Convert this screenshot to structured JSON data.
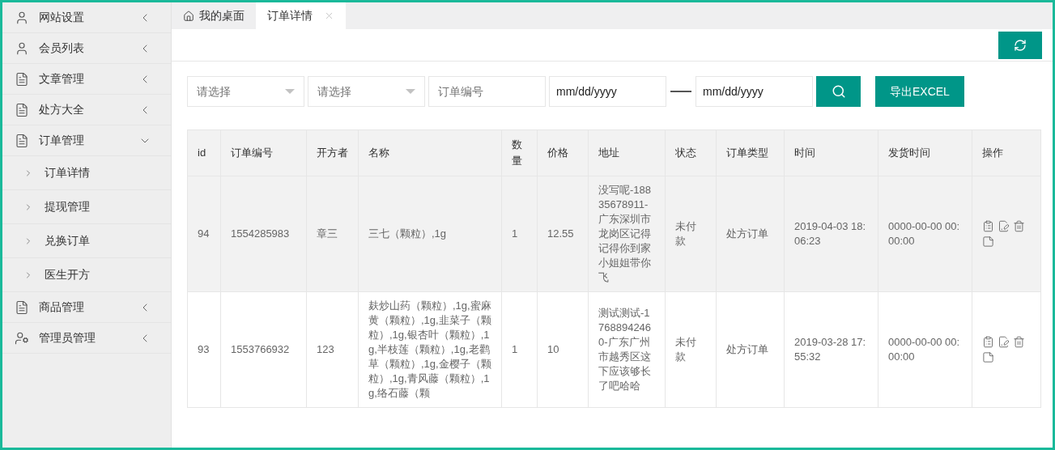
{
  "sidebar": {
    "items": [
      {
        "label": "网站设置",
        "kind": "user",
        "expanded": false
      },
      {
        "label": "会员列表",
        "kind": "user",
        "expanded": false
      },
      {
        "label": "文章管理",
        "kind": "doc",
        "expanded": false
      },
      {
        "label": "处方大全",
        "kind": "doc",
        "expanded": false
      },
      {
        "label": "订单管理",
        "kind": "doc",
        "expanded": true,
        "children": [
          {
            "label": "订单详情"
          },
          {
            "label": "提现管理"
          },
          {
            "label": "兑换订单"
          },
          {
            "label": "医生开方"
          }
        ]
      },
      {
        "label": "商品管理",
        "kind": "doc",
        "expanded": false
      },
      {
        "label": "管理员管理",
        "kind": "admin",
        "expanded": false
      }
    ]
  },
  "tabs": [
    {
      "label": "我的桌面",
      "kind": "home",
      "selected": false
    },
    {
      "label": "订单详情",
      "kind": "closable",
      "selected": true
    }
  ],
  "filters": {
    "selects": [
      {
        "placeholder": "请选择"
      },
      {
        "placeholder": "请选择"
      }
    ],
    "order_number": {
      "placeholder": "订单编号"
    },
    "date_from": {
      "placeholder": "mm/dd/yyyy"
    },
    "date_to": {
      "placeholder": "mm/dd/yyyy"
    },
    "export_button": "导出EXCEL"
  },
  "table": {
    "columns": [
      "id",
      "订单编号",
      "开方者",
      "名称",
      "数量",
      "价格",
      "地址",
      "状态",
      "订单类型",
      "时间",
      "发货时间",
      "操作"
    ],
    "rows": [
      {
        "hovered": true,
        "cells": [
          "94",
          "1554285983",
          "章三",
          "三七（颗粒）,1g",
          "1",
          "12.55",
          "没写呢-18835678911-广东深圳市龙岗区记得记得你到家小姐姐带你飞",
          "未付款",
          "处方订单",
          "2019-04-03 18:06:23",
          "0000-00-00 00:00:00"
        ]
      },
      {
        "hovered": false,
        "cells": [
          "93",
          "1553766932",
          "123",
          "麸炒山药（颗粒）,1g,蜜麻黄（颗粒）,1g,韭菜子（颗粒）,1g,银杏叶（颗粒）,1g,半枝莲（颗粒）,1g,老鹳草（颗粒）,1g,金樱子（颗粒）,1g,青风藤（颗粒）,1g,络石藤（颗",
          "1",
          "10",
          "测试测试-17688942460-广东广州市越秀区这下应该够长了吧哈哈",
          "未付款",
          "处方订单",
          "2019-03-28 17:55:32",
          "0000-00-00 00:00:00"
        ]
      }
    ]
  }
}
